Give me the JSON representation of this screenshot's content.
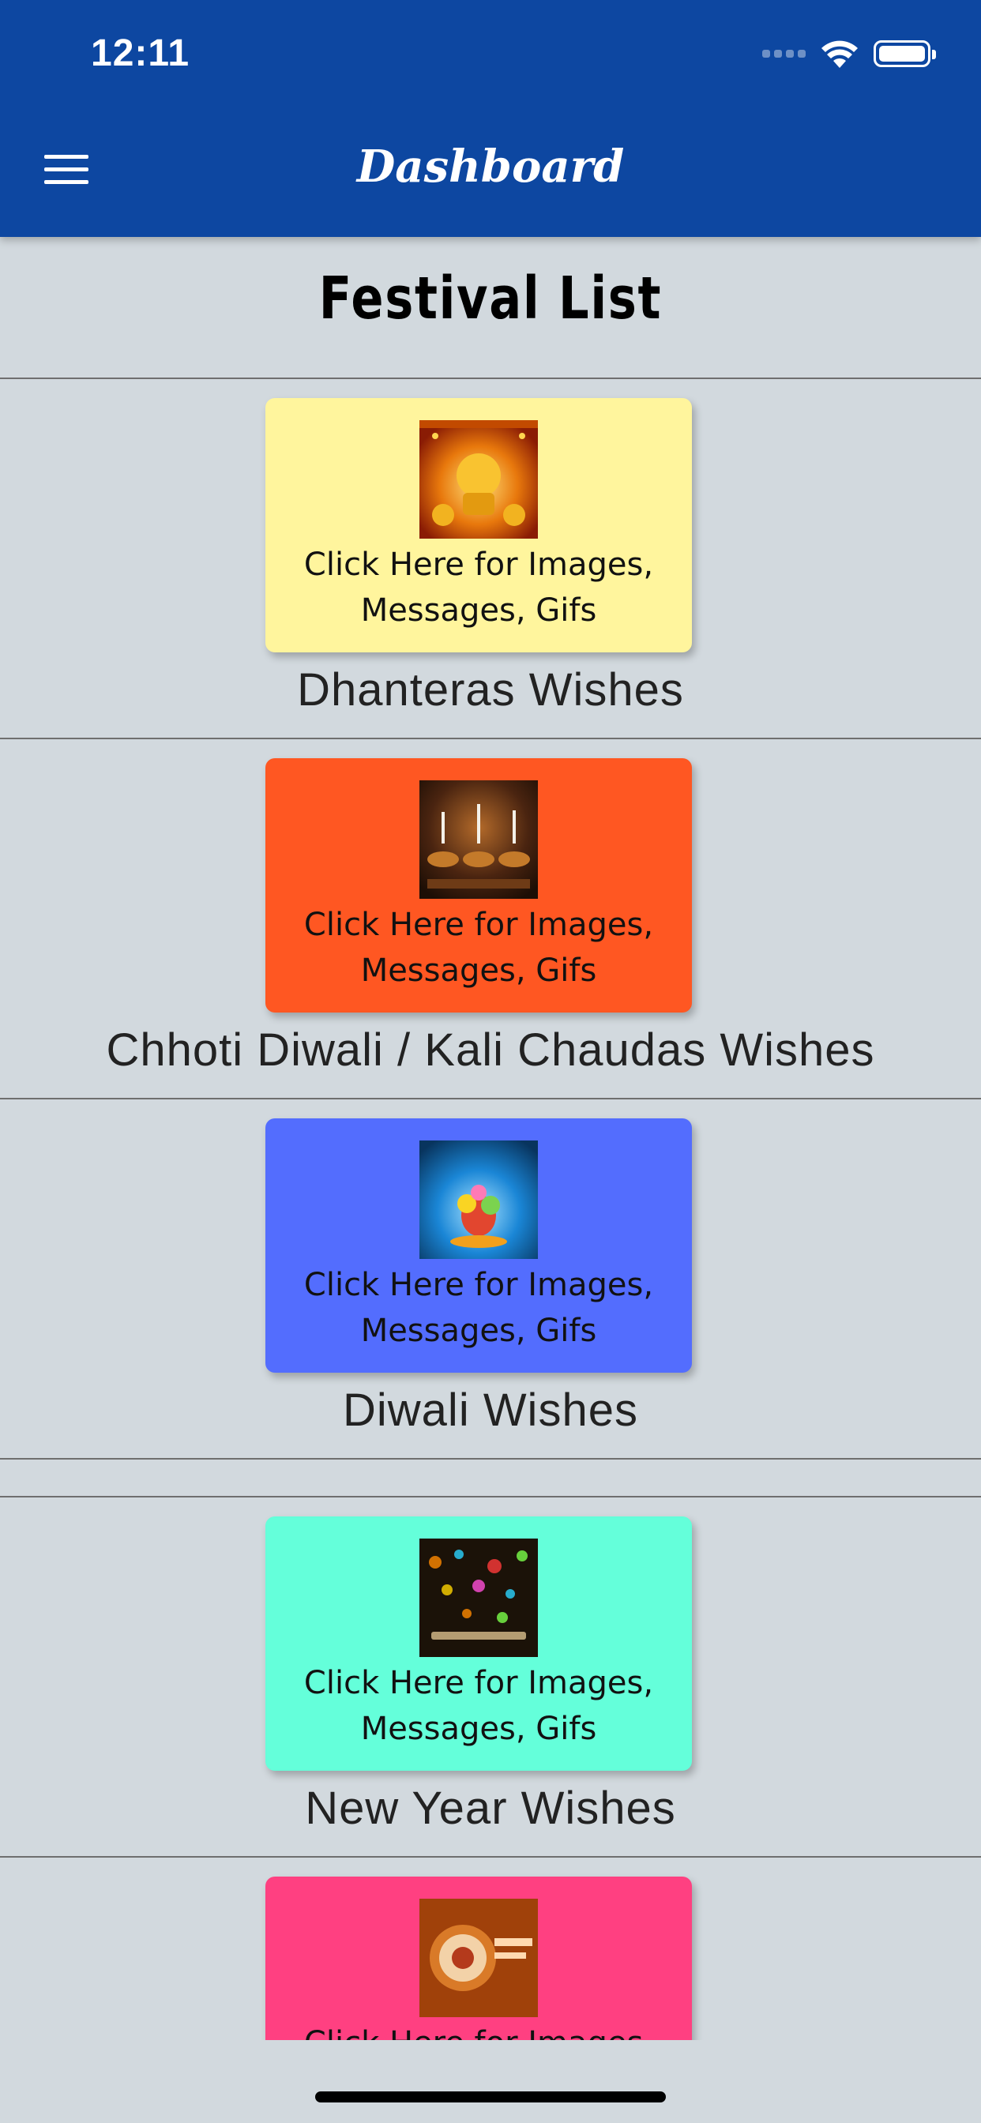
{
  "status_bar": {
    "time": "12:11"
  },
  "header": {
    "title": "Dashboard",
    "menu_icon": "hamburger-menu-icon"
  },
  "section": {
    "title": "Festival List"
  },
  "card_caption": "Click Here for Images, Messages, Gifs",
  "festivals": [
    {
      "name": "Dhanteras Wishes",
      "card_color": "#fff59d",
      "caption": "Click Here for Images, Messages, Gifs"
    },
    {
      "name": "Chhoti Diwali / Kali Chaudas Wishes",
      "card_color": "#ff5722",
      "caption": "Click Here for Images, Messages, Gifs"
    },
    {
      "name": "Diwali Wishes",
      "card_color": "#536dfe",
      "caption": "Click Here for Images, Messages, Gifs"
    },
    {
      "name": "New Year Wishes",
      "card_color": "#64ffda",
      "caption": "Click Here for Images, Messages, Gifs"
    },
    {
      "name": "",
      "card_color": "#ff4081",
      "caption": "Click Here for Images, Messages, Gifs"
    }
  ],
  "colors": {
    "header": "#0d47a1",
    "background": "#d2d9de"
  }
}
